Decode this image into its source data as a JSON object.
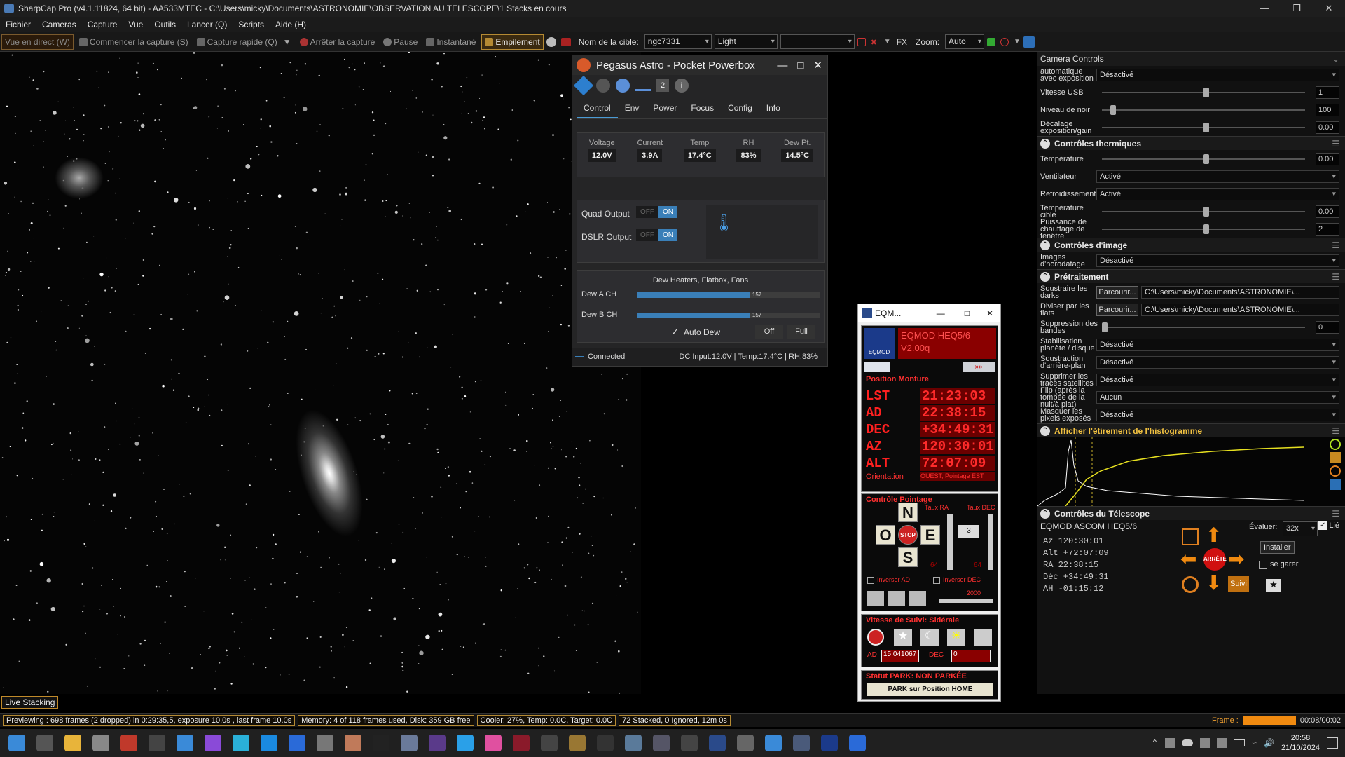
{
  "app": {
    "title": "SharpCap Pro (v4.1.11824, 64 bit) - AA533MTEC - C:\\Users\\micky\\Documents\\ASTRONOMIE\\OBSERVATION AU TELESCOPE\\1 Stacks en cours"
  },
  "menu": [
    "Fichier",
    "Cameras",
    "Capture",
    "Vue",
    "Outils",
    "Lancer (Q)",
    "Scripts",
    "Aide (H)"
  ],
  "toolbar": {
    "live_view": "Vue en direct (W)",
    "start_capture": "Commencer la capture (S)",
    "quick_capture": "Capture rapide (Q)",
    "stop_capture": "Arrêter la capture",
    "pause": "Pause",
    "snapshot": "Instantané",
    "stacking": "Empilement",
    "target_label": "Nom de la cible:",
    "target_value": "ngc7331",
    "frame_type": "Light",
    "fx_label": "FX",
    "zoom_label": "Zoom:",
    "zoom_value": "Auto"
  },
  "live_stacking_label": "Live Stacking",
  "status": {
    "preview": "Previewing : 698 frames (2 dropped) in 0:29:35,5, exposure 10.0s , last frame 10.0s",
    "memory": "Memory: 4 of 118 frames used, Disk: 359 GB free",
    "cooler": "Cooler: 27%, Temp: 0.0C, Target: 0.0C",
    "stacked": "72 Stacked, 0 Ignored, 12m 0s",
    "frame_label": "Frame :",
    "frame_time": "00:08/00:02"
  },
  "right_panel": {
    "camera_controls": "Camera Controls",
    "rows_top": [
      {
        "label": "automatique avec exposition",
        "dropdown": "Désactivé"
      },
      {
        "label": "Vitesse USB",
        "value": "1"
      },
      {
        "label": "Niveau de noir",
        "value": "100"
      },
      {
        "label": "Décalage exposition/gain",
        "value": "0.00"
      }
    ],
    "thermal": {
      "title": "Contrôles thermiques",
      "temp_label": "Température",
      "temp_value": "0.00",
      "fan_label": "Ventilateur",
      "fan_value": "Activé",
      "cooling_label": "Refroidissement",
      "cooling_value": "Activé",
      "target_label": "Température cible",
      "target_value": "0.00",
      "heater_label": "Puissance de chauffage de fenêtre",
      "heater_value": "2"
    },
    "image": {
      "title": "Contrôles d'image",
      "timestamp_label": "Images d'horodatage",
      "timestamp_value": "Désactivé"
    },
    "preprocessing": {
      "title": "Prétraitement",
      "darks_label": "Soustraire les darks",
      "flats_label": "Diviser par les flats",
      "browse": "Parcourir...",
      "path": "C:\\Users\\micky\\Documents\\ASTRONOMIE\\...",
      "banding_label": "Suppression des bandes",
      "banding_value": "0",
      "stab_label": "Stabilisation planète / disque",
      "stab_value": "Désactivé",
      "bg_label": "Soustraction d'arrière-plan",
      "bg_value": "Désactivé",
      "sat_label": "Supprimer les traces satellites",
      "sat_value": "Désactivé",
      "flip_label": "Flip (après la tombée de la nuit/à plat)",
      "flip_value": "Aucun",
      "mask_label": "Masquer les pixels exposés",
      "mask_value": "Désactivé"
    },
    "histogram_title": "Afficher l'étirement de l'histogramme",
    "telescope": {
      "title": "Contrôles du Télescope",
      "mount": "EQMOD ASCOM HEQ5/6",
      "linked": "Lié",
      "az": "Az   120:30:01",
      "alt": "Alt  +72:07:09",
      "ra": "RA    22:38:15",
      "dec": "Déc  +34:49:31",
      "ah": "AH   -01:15:12",
      "rate_label": "Évaluer:",
      "rate_value": "32x",
      "install": "Installer",
      "park": "se garer",
      "stop": "ARRÊTE",
      "track": "Suivi"
    }
  },
  "pegasus": {
    "title": "Pegasus Astro - Pocket Powerbox",
    "badge": "2",
    "tabs": [
      "Control",
      "Env",
      "Power",
      "Focus",
      "Config",
      "Info"
    ],
    "readings": [
      {
        "label": "Voltage",
        "value": "12.0V"
      },
      {
        "label": "Current",
        "value": "3.9A"
      },
      {
        "label": "Temp",
        "value": "17.4°C"
      },
      {
        "label": "RH",
        "value": "83%"
      },
      {
        "label": "Dew Pt.",
        "value": "14.5°C"
      }
    ],
    "quad_output": "Quad Output",
    "dslr_output": "DSLR Output",
    "off": "OFF",
    "on": "ON",
    "dew_section": "Dew Heaters, Flatbox, Fans",
    "dew_a": "Dew A CH",
    "dew_a_value": "157",
    "dew_a_fraction": 0.615,
    "dew_b": "Dew B CH",
    "dew_b_value": "157",
    "dew_b_fraction": 0.615,
    "auto_dew": "Auto Dew",
    "off_btn": "Off",
    "full_btn": "Full",
    "connected": "Connected",
    "footer": "DC Input:12.0V | Temp:17.4°C | RH:83%"
  },
  "eqmod": {
    "title": "EQM...",
    "logo": "EQMOD",
    "model": "EQMOD HEQ5/6",
    "version": "V2.00q",
    "position_title": "Position Monture",
    "lst_label": "LST",
    "lst": "21:23:03",
    "ad_label": "AD",
    "ad": "22:38:15",
    "dec_label": "DEC",
    "dec": "+34:49:31",
    "az_label": "AZ",
    "az": "120:30:01",
    "alt_label": "ALT",
    "alt": "72:07:09",
    "orient_label": "Orientation",
    "orient": "OUEST, Pointage EST",
    "pointing_title": "Contrôle Pointage",
    "rate_ra": "Taux RA",
    "rate_dec": "Taux DEC",
    "n": "N",
    "s": "S",
    "e": "E",
    "o": "O",
    "stop": "STOP",
    "rate_sel": "3",
    "ra_rate_val": "64",
    "dec_rate_val": "64",
    "inv_ad": "Inverser AD",
    "inv_dec": "Inverser DEC",
    "speed_val": "2000",
    "tracking_title": "Vitesse de Suivi: Sidérale",
    "ad_rate_label": "AD",
    "ad_rate": "15,041067",
    "dec_rate_label": "DEC",
    "dec_rate": "0",
    "park_status": "Statut PARK: NON PARKÉE",
    "park_btn": "PARK sur Position HOME"
  },
  "taskbar": {
    "time": "20:58",
    "date": "21/10/2024"
  }
}
